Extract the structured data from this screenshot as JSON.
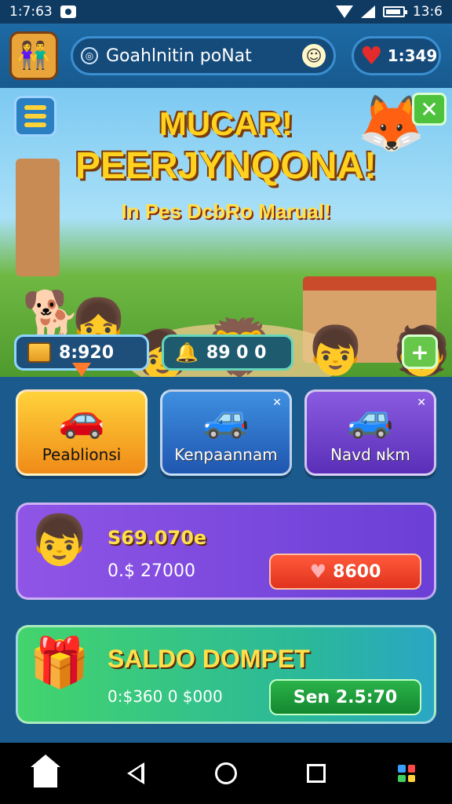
{
  "status_bar": {
    "time": "1:7:63",
    "battery_text": "13:6"
  },
  "header": {
    "search_title": "Goahlnitin poNat",
    "lives": "1:349"
  },
  "banner": {
    "title_line1": "MUCAR!",
    "title_line2": "PEERJYNQONA!",
    "subtitle": "In Pes DcbRo Marual!",
    "resource1": "8:920",
    "resource2": "89 0 0"
  },
  "categories": [
    {
      "label": "Peablionsi"
    },
    {
      "label": "Kenpaannam"
    },
    {
      "label": "Navd ɴkm"
    }
  ],
  "panel1": {
    "title": "S69.070e",
    "amount": "0.$ 27000",
    "button_label": "8600"
  },
  "panel2": {
    "title": "SALDO DOMPET",
    "amount": "0:$360 0  $000",
    "button_label": "Sen 2.5:70"
  },
  "colors": {
    "accent_gold": "#ffd21f",
    "panel_purple": "#8f55e6",
    "panel_green": "#43d46d",
    "button_red": "#e0331e",
    "button_green": "#12872e"
  }
}
